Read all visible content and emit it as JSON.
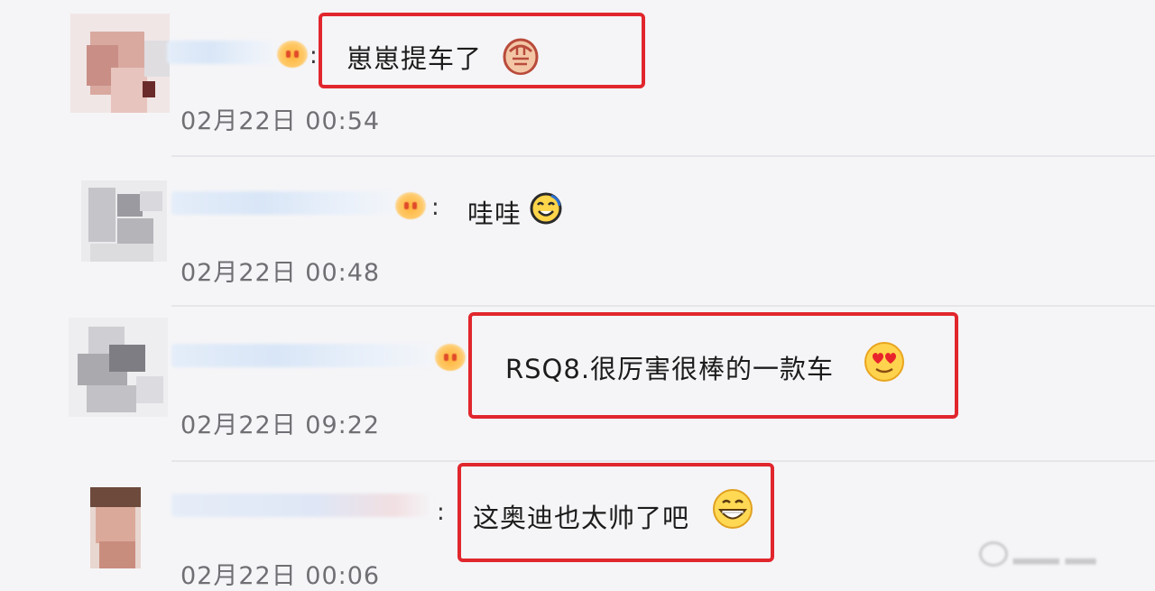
{
  "comments": [
    {
      "text": "崽崽提车了",
      "colon": ":",
      "emoji": "fist-emoji",
      "time": "02月22日 00:54",
      "highlighted": true
    },
    {
      "text": "哇哇",
      "colon": ":",
      "emoji": "smile-emoji",
      "time": "02月22日 00:48",
      "highlighted": false
    },
    {
      "text": "RSQ8.很厉害很棒的一款车",
      "colon": "",
      "emoji": "heart-eyes-emoji",
      "time": "02月22日 09:22",
      "highlighted": true
    },
    {
      "text": "这奥迪也太帅了吧",
      "colon": ":",
      "emoji": "grin-emoji",
      "time": "02月22日 00:06",
      "highlighted": true
    }
  ],
  "colors": {
    "highlight": "#e1262d",
    "badge": "#ffb43a",
    "time": "#6f6f74"
  }
}
